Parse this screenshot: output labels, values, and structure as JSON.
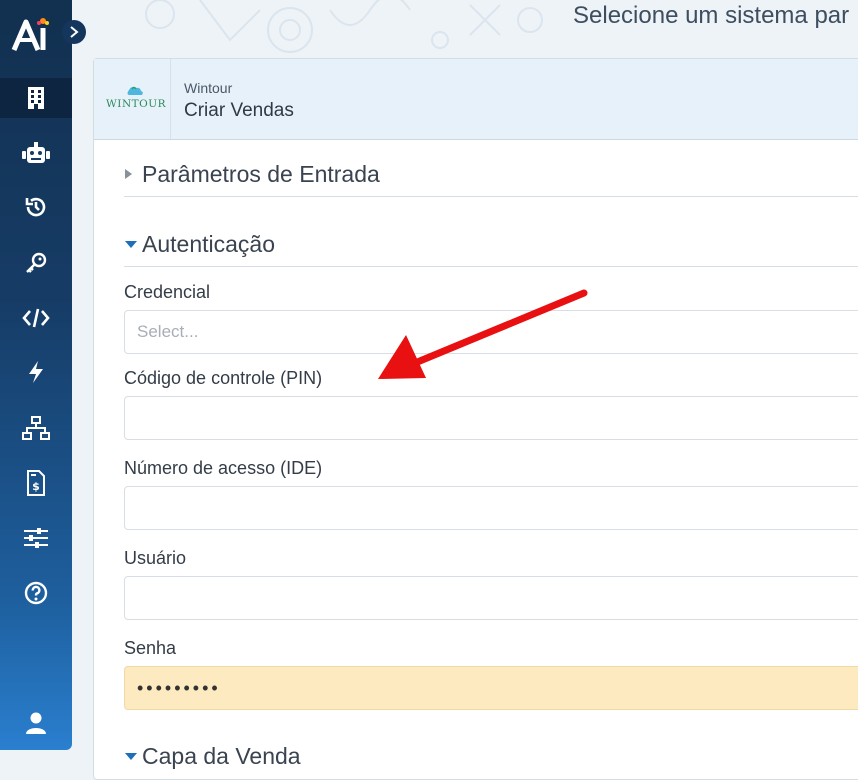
{
  "header": {
    "title": "Selecione um sistema par"
  },
  "sidebar": {
    "items": [
      {
        "icon": "building-icon",
        "active": true
      },
      {
        "icon": "robot-icon"
      },
      {
        "icon": "history-icon"
      },
      {
        "icon": "key-icon"
      },
      {
        "icon": "code-icon"
      },
      {
        "icon": "lightning-icon"
      },
      {
        "icon": "network-icon"
      },
      {
        "icon": "invoice-icon"
      },
      {
        "icon": "sliders-icon"
      },
      {
        "icon": "help-icon"
      },
      {
        "icon": "user-icon"
      }
    ]
  },
  "panel": {
    "system_name": "Wintour",
    "action_name": "Criar Vendas",
    "logo_text": "WINTOUR"
  },
  "sections": {
    "params": "Parâmetros de Entrada",
    "auth": "Autenticação",
    "capa": "Capa da Venda"
  },
  "fields": {
    "credencial": {
      "label": "Credencial",
      "placeholder": "Select..."
    },
    "pin": {
      "label": "Código de controle (PIN)",
      "value": ""
    },
    "ide": {
      "label": "Número de acesso (IDE)",
      "value": ""
    },
    "usuario": {
      "label": "Usuário",
      "value": ""
    },
    "senha": {
      "label": "Senha",
      "value": "•••••••••"
    }
  },
  "colors": {
    "sidebar_top": "#12304f",
    "sidebar_bottom": "#2a7fcf",
    "accent": "#1f6fb8",
    "autofill": "#fdeac0",
    "arrow": "#e81010"
  }
}
